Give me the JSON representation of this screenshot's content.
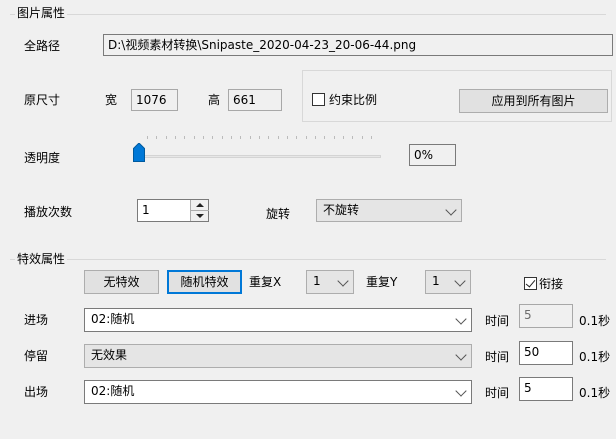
{
  "image_props": {
    "title": "图片属性",
    "fullpath_label": "全路径",
    "fullpath_value": "D:\\视频素材转换\\Snipaste_2020-04-23_20-06-44.png",
    "orig_size_label": "原尺寸",
    "width_label": "宽",
    "width_value": "1076",
    "height_label": "高",
    "height_value": "661",
    "keep_ratio_label": "约束比例",
    "keep_ratio_checked": false,
    "apply_all_label": "应用到所有图片",
    "opacity_label": "透明度",
    "opacity_value": "0%",
    "opacity_level": 0,
    "play_count_label": "播放次数",
    "play_count_value": "1",
    "rotate_label": "旋转",
    "rotate_value": "不旋转"
  },
  "effect_props": {
    "title": "特效属性",
    "no_effect_label": "无特效",
    "random_effect_label": "随机特效",
    "repeat_x_label": "重复X",
    "repeat_x_value": "1",
    "repeat_y_label": "重复Y",
    "repeat_y_value": "1",
    "link_label": "衔接",
    "link_checked": true,
    "rows": [
      {
        "label": "进场",
        "value": "02:随机",
        "time_label": "时间",
        "time_value": "5",
        "unit": "0.1秒"
      },
      {
        "label": "停留",
        "value": "无效果",
        "time_label": "时间",
        "time_value": "50",
        "unit": "0.1秒"
      },
      {
        "label": "出场",
        "value": "02:随机",
        "time_label": "时间",
        "time_value": "5",
        "unit": "0.1秒"
      }
    ]
  }
}
